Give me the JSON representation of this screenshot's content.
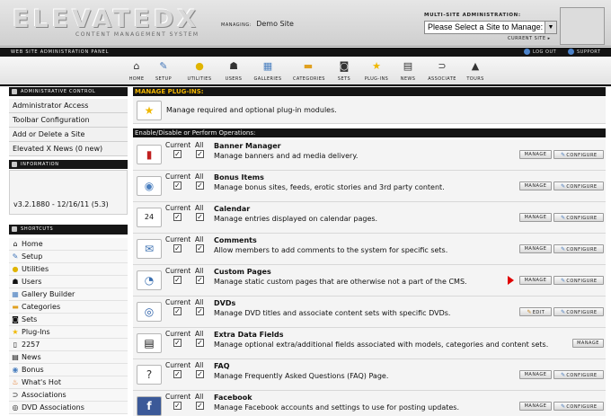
{
  "header": {
    "logo_text": "ELEVATEDX",
    "logo_sub": "CONTENT MANAGEMENT SYSTEM",
    "managing_label": "MANAGING:",
    "managing_value": "Demo Site",
    "multisite_label": "MULTI-SITE ADMINISTRATION:",
    "site_select_value": "Please Select a Site to Manage:",
    "current_site_label": "CURRENT SITE"
  },
  "topbar": {
    "title": "WEB SITE ADMINISTRATION PANEL",
    "logout": "LOG OUT",
    "support": "SUPPORT"
  },
  "nav": [
    {
      "label": "HOME",
      "icon": "home-icon"
    },
    {
      "label": "SETUP",
      "icon": "wrench-icon"
    },
    {
      "label": "UTILITIES",
      "icon": "lightbulb-icon"
    },
    {
      "label": "USERS",
      "icon": "users-icon"
    },
    {
      "label": "GALLERIES",
      "icon": "gallery-icon"
    },
    {
      "label": "CATEGORIES",
      "icon": "folder-icon"
    },
    {
      "label": "SETS",
      "icon": "camera-icon"
    },
    {
      "label": "PLUG-INS",
      "icon": "star-icon"
    },
    {
      "label": "NEWS",
      "icon": "news-icon"
    },
    {
      "label": "ASSOCIATE",
      "icon": "paperclip-icon"
    },
    {
      "label": "TOURS",
      "icon": "cone-icon"
    }
  ],
  "sidebar": {
    "admin_title": "ADMINISTRATIVE CONTROL",
    "admin_links": [
      "Administrator Access",
      "Toolbar Configuration",
      "Add or Delete a Site",
      "Elevated X News (0 new)"
    ],
    "info_title": "INFORMATION",
    "version": "v3.2.1880 - 12/16/11 (5.3)",
    "shortcuts_title": "SHORTCUTS",
    "shortcuts": [
      {
        "label": "Home",
        "icon": "home-icon"
      },
      {
        "label": "Setup",
        "icon": "wrench-icon"
      },
      {
        "label": "Utilities",
        "icon": "lightbulb-icon"
      },
      {
        "label": "Users",
        "icon": "users-icon"
      },
      {
        "label": "Gallery Builder",
        "icon": "gallery-icon"
      },
      {
        "label": "Categories",
        "icon": "folder-icon"
      },
      {
        "label": "Sets",
        "icon": "camera-icon"
      },
      {
        "label": "Plug-Ins",
        "icon": "star-icon"
      },
      {
        "label": "2257",
        "icon": "document-icon"
      },
      {
        "label": "News",
        "icon": "news-icon"
      },
      {
        "label": "Bonus",
        "icon": "bonus-icon"
      },
      {
        "label": "What's Hot",
        "icon": "flame-icon"
      },
      {
        "label": "Associations",
        "icon": "paperclip-icon"
      },
      {
        "label": "DVD Associations",
        "icon": "dvd-icon"
      }
    ]
  },
  "main": {
    "manage_title": "MANAGE PLUG-INS:",
    "manage_desc": "Manage required and optional plug-in modules.",
    "ops_title": "Enable/Disable or Perform Operations:",
    "col_current": "Current",
    "col_all": "All",
    "btn_manage": "MANAGE",
    "btn_configure": "CONFIGURE",
    "btn_edit": "EDIT",
    "plugins": [
      {
        "title": "Banner Manager",
        "desc": "Manage banners and ad media delivery.",
        "icon": "banner-icon",
        "actions": "manage-configure"
      },
      {
        "title": "Bonus Items",
        "desc": "Manage bonus sites, feeds, erotic stories and 3rd party content.",
        "icon": "bonus-icon",
        "actions": "manage-configure"
      },
      {
        "title": "Calendar",
        "desc": "Manage entries displayed on calendar pages.",
        "icon": "calendar-icon",
        "actions": "manage-configure"
      },
      {
        "title": "Comments",
        "desc": "Allow members to add comments to the system for specific sets.",
        "icon": "comments-icon",
        "actions": "manage-configure"
      },
      {
        "title": "Custom Pages",
        "desc": "Manage static custom pages that are otherwise not a part of the CMS.",
        "icon": "custom-pages-icon",
        "actions": "manage-configure"
      },
      {
        "title": "DVDs",
        "desc": "Manage DVD titles and associate content sets with specific DVDs.",
        "icon": "dvd-icon",
        "actions": "edit-configure"
      },
      {
        "title": "Extra Data Fields",
        "desc": "Manage optional extra/additional fields associated with models, categories and content sets.",
        "icon": "extra-fields-icon",
        "actions": "manage-only"
      },
      {
        "title": "FAQ",
        "desc": "Manage Frequently Asked Questions (FAQ) Page.",
        "icon": "faq-icon",
        "actions": "manage-configure"
      },
      {
        "title": "Facebook",
        "desc": "Manage Facebook accounts and settings to use for posting updates.",
        "icon": "facebook-icon",
        "actions": "manage-configure"
      }
    ]
  }
}
